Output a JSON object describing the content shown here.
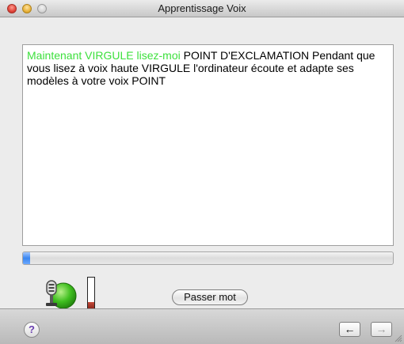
{
  "window": {
    "title": "Apprentissage Voix"
  },
  "text_panel": {
    "read_text": "Maintenant VIRGULE lisez-moi",
    "unread_text": " POINT D'EXCLAMATION Pendant que vous lisez à voix haute VIRGULE l'ordinateur écoute et adapte ses modèles à votre voix POINT",
    "read_color": "#3de03d"
  },
  "progress": {
    "value": 0.02
  },
  "microphone": {
    "icon": "microphone-icon",
    "status_color": "#3fbf1f"
  },
  "level_meter": {
    "level": 0.27,
    "color": "#a8372a"
  },
  "buttons": {
    "skip_word_label": "Passer mot",
    "help_glyph": "?",
    "back_glyph": "←",
    "forward_glyph": "→"
  }
}
